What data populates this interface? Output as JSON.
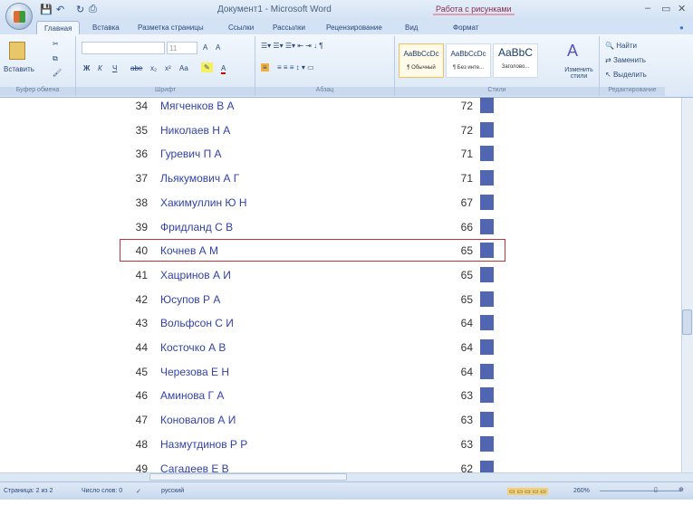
{
  "window": {
    "title": "Документ1 - Microsoft Word",
    "context_tab_group": "Работа с рисунками",
    "controls": [
      "–",
      "▭",
      "✕"
    ]
  },
  "quick_access": {
    "icons": [
      "save-icon",
      "undo-icon",
      "redo-icon",
      "print-icon"
    ]
  },
  "tabs": [
    {
      "label": "Главная",
      "active": true
    },
    {
      "label": "Вставка"
    },
    {
      "label": "Разметка страницы"
    },
    {
      "label": "Ссылки"
    },
    {
      "label": "Рассылки"
    },
    {
      "label": "Рецензирование"
    },
    {
      "label": "Вид"
    },
    {
      "label": "Формат"
    }
  ],
  "ribbon": {
    "clipboard": {
      "paste": "Вставить",
      "label": "Буфер обмена"
    },
    "font": {
      "name": "",
      "size": "11",
      "label": "Шрифт",
      "buttons": [
        "Ж",
        "К",
        "Ч",
        "abe",
        "x₂",
        "x²",
        "Aa",
        "A",
        "A"
      ]
    },
    "paragraph": {
      "label": "Абзац"
    },
    "styles": {
      "label": "Стили",
      "items": [
        {
          "preview": "AaBbCcDc",
          "name": "¶ Обычный",
          "selected": true
        },
        {
          "preview": "AaBbCcDc",
          "name": "¶ Без инте..."
        },
        {
          "preview": "AaBbC",
          "name": "Заголово..."
        }
      ],
      "change": "Изменить стили"
    },
    "editing": {
      "label": "Редактирование",
      "find": "Найти",
      "replace": "Заменить",
      "select": "Выделить"
    }
  },
  "document": {
    "rows": [
      {
        "num": "34",
        "name": "Мягченков В А",
        "value": "72"
      },
      {
        "num": "35",
        "name": "Николаев Н А",
        "value": "72"
      },
      {
        "num": "36",
        "name": "Гуревич П А",
        "value": "71"
      },
      {
        "num": "37",
        "name": "Льякумович А Г",
        "value": "71"
      },
      {
        "num": "38",
        "name": "Хакимуллин Ю Н",
        "value": "67"
      },
      {
        "num": "39",
        "name": "Фридланд С В",
        "value": "66"
      },
      {
        "num": "40",
        "name": "Кочнев А М",
        "value": "65",
        "highlighted": true
      },
      {
        "num": "41",
        "name": "Хацринов А И",
        "value": "65"
      },
      {
        "num": "42",
        "name": "Юсупов Р А",
        "value": "65"
      },
      {
        "num": "43",
        "name": "Вольфсон С И",
        "value": "64"
      },
      {
        "num": "44",
        "name": "Косточко А В",
        "value": "64"
      },
      {
        "num": "45",
        "name": "Черезова Е Н",
        "value": "64"
      },
      {
        "num": "46",
        "name": "Аминова Г А",
        "value": "63"
      },
      {
        "num": "47",
        "name": "Коновалов А И",
        "value": "63"
      },
      {
        "num": "48",
        "name": "Назмутдинов Р Р",
        "value": "63"
      },
      {
        "num": "49",
        "name": "Сагадеев Е В",
        "value": "62"
      }
    ],
    "highlight_color": "#c0333a",
    "bar_color": "#5066b0"
  },
  "status": {
    "page": "Страница: 2 из 2",
    "words": "Число слов: 0",
    "language": "русский",
    "zoom": "260%"
  }
}
